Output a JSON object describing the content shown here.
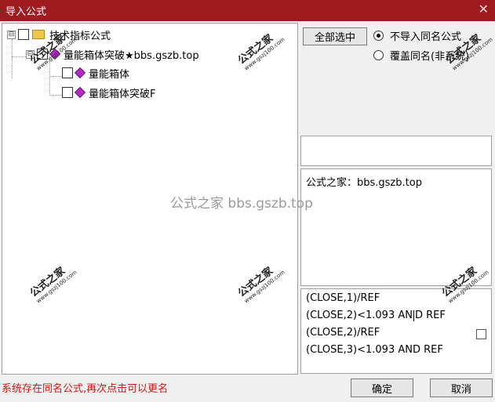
{
  "window": {
    "title": "导入公式",
    "close_glyph": "✕"
  },
  "tree": {
    "root": {
      "expander": "⊟",
      "label": "技术指标公式"
    },
    "group": {
      "expander": "⊟",
      "label": "量能箱体突破★bbs.gszb.top"
    },
    "items": [
      {
        "label": "量能箱体"
      },
      {
        "label": "量能箱体突破F"
      }
    ]
  },
  "buttons": {
    "select_all": "全部选中",
    "ok": "确定",
    "cancel": "取消"
  },
  "options": {
    "no_import_same_name": "不导入同名公式",
    "overwrite_same_name": "覆盖同名(非系统)",
    "selected": "no_import_same_name"
  },
  "info_box": {
    "text": "公式之家：bbs.gszb.top"
  },
  "code_box": {
    "lines": [
      "(CLOSE,1)/REF",
      "(CLOSE,2)<1.093 AND REF",
      "(CLOSE,2)/REF",
      "(CLOSE,3)<1.093 AND REF"
    ],
    "line2_before_cursor": "(CLOSE,2)<1.093 AN",
    "line2_after_cursor": "D REF"
  },
  "status": {
    "text": "系统存在同名公式,再次点击可以更名"
  },
  "watermarks": {
    "center": "公式之家 bbs.gszb.top",
    "stamp_big": "公式之家",
    "stamp_small": "www.gszj100.com"
  }
}
